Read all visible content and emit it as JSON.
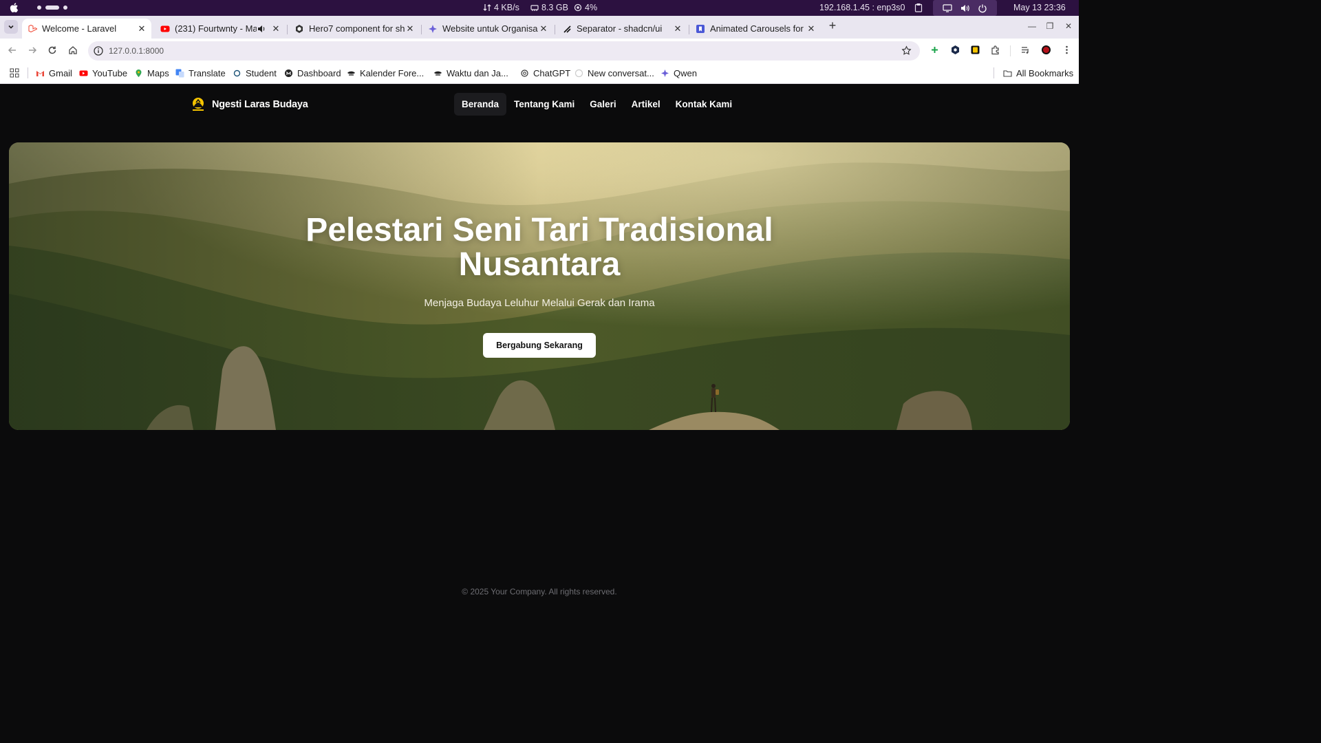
{
  "os_bar": {
    "net_speed": "4 KB/s",
    "memory": "8.3 GB",
    "cpu": "4%",
    "network": "192.168.1.45 : enp3s0",
    "datetime": "May 13  23:36"
  },
  "tabs": [
    {
      "title": "Welcome - Laravel",
      "icon": "laravel-icon",
      "active": true
    },
    {
      "title": "(231) Fourtwnty - Mar",
      "icon": "youtube-icon",
      "audio": true
    },
    {
      "title": "Hero7 component for sh",
      "icon": "shadcnblocks-icon"
    },
    {
      "title": "Website untuk Organisas",
      "icon": "deepseek-icon"
    },
    {
      "title": "Separator - shadcn/ui",
      "icon": "shadcn-icon"
    },
    {
      "title": "Animated Carousels for R",
      "icon": "bookmark-icon"
    }
  ],
  "toolbar": {
    "url": "127.0.0.1:8000"
  },
  "bookmarks": [
    {
      "label": "Gmail",
      "icon": "gmail-icon"
    },
    {
      "label": "YouTube",
      "icon": "youtube-icon"
    },
    {
      "label": "Maps",
      "icon": "maps-icon"
    },
    {
      "label": "Translate",
      "icon": "translate-icon"
    },
    {
      "label": "Student",
      "icon": "student-icon"
    },
    {
      "label": "Dashboard",
      "icon": "dashboard-icon"
    },
    {
      "label": "Kalender Fore...",
      "icon": "calendar-icon"
    },
    {
      "label": "Waktu dan Ja...",
      "icon": "clock-icon"
    },
    {
      "label": "ChatGPT",
      "icon": "chatgpt-icon"
    },
    {
      "label": "New conversat...",
      "icon": "chat-icon"
    },
    {
      "label": "Qwen",
      "icon": "qwen-icon"
    }
  ],
  "all_bookmarks": "All Bookmarks",
  "site": {
    "brand": "Ngesti Laras Budaya",
    "nav": [
      {
        "label": "Beranda",
        "active": true
      },
      {
        "label": "Tentang Kami"
      },
      {
        "label": "Galeri"
      },
      {
        "label": "Artikel"
      },
      {
        "label": "Kontak Kami"
      }
    ],
    "hero": {
      "title_line1": "Pelestari Seni Tari Tradisional",
      "title_line2": "Nusantara",
      "subtitle": "Menjaga Budaya Leluhur Melalui Gerak dan Irama",
      "cta": "Bergabung Sekarang"
    },
    "footer": "© 2025 Your Company. All rights reserved."
  },
  "colors": {
    "os_bar": "#2c1140",
    "tab_strip": "#e9e6f0",
    "page_bg": "#0b0b0c",
    "hero_sky": "#c8b982"
  }
}
